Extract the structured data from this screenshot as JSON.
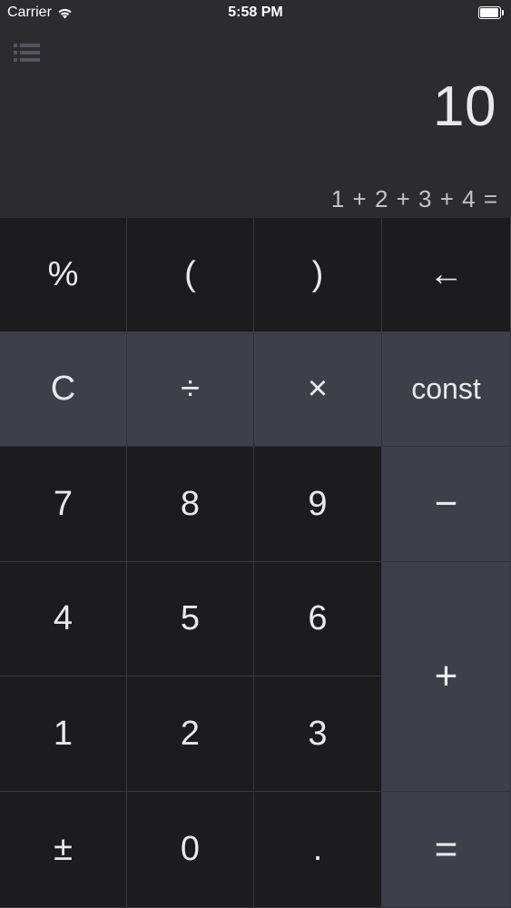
{
  "status_bar": {
    "carrier": "Carrier",
    "time": "5:58 PM",
    "wifi_icon": "wifi-icon",
    "battery_icon": "battery-icon"
  },
  "display": {
    "menu_icon": "list-icon",
    "result": "10",
    "expression": "1 + 2 + 3 + 4 ="
  },
  "keypad": {
    "row1": [
      "%",
      "(",
      ")",
      "←"
    ],
    "row2": [
      "C",
      "÷",
      "×",
      "const"
    ],
    "row3": [
      "7",
      "8",
      "9",
      "−"
    ],
    "row4": [
      "4",
      "5",
      "6",
      "+"
    ],
    "row5": [
      "1",
      "2",
      "3"
    ],
    "row6": [
      "±",
      "0",
      ".",
      "="
    ]
  },
  "colors": {
    "display_bg": "#2b2b30",
    "key_dark": "#1c1c1e",
    "key_gray": "#3e4049",
    "text": "#e9e9ec"
  }
}
